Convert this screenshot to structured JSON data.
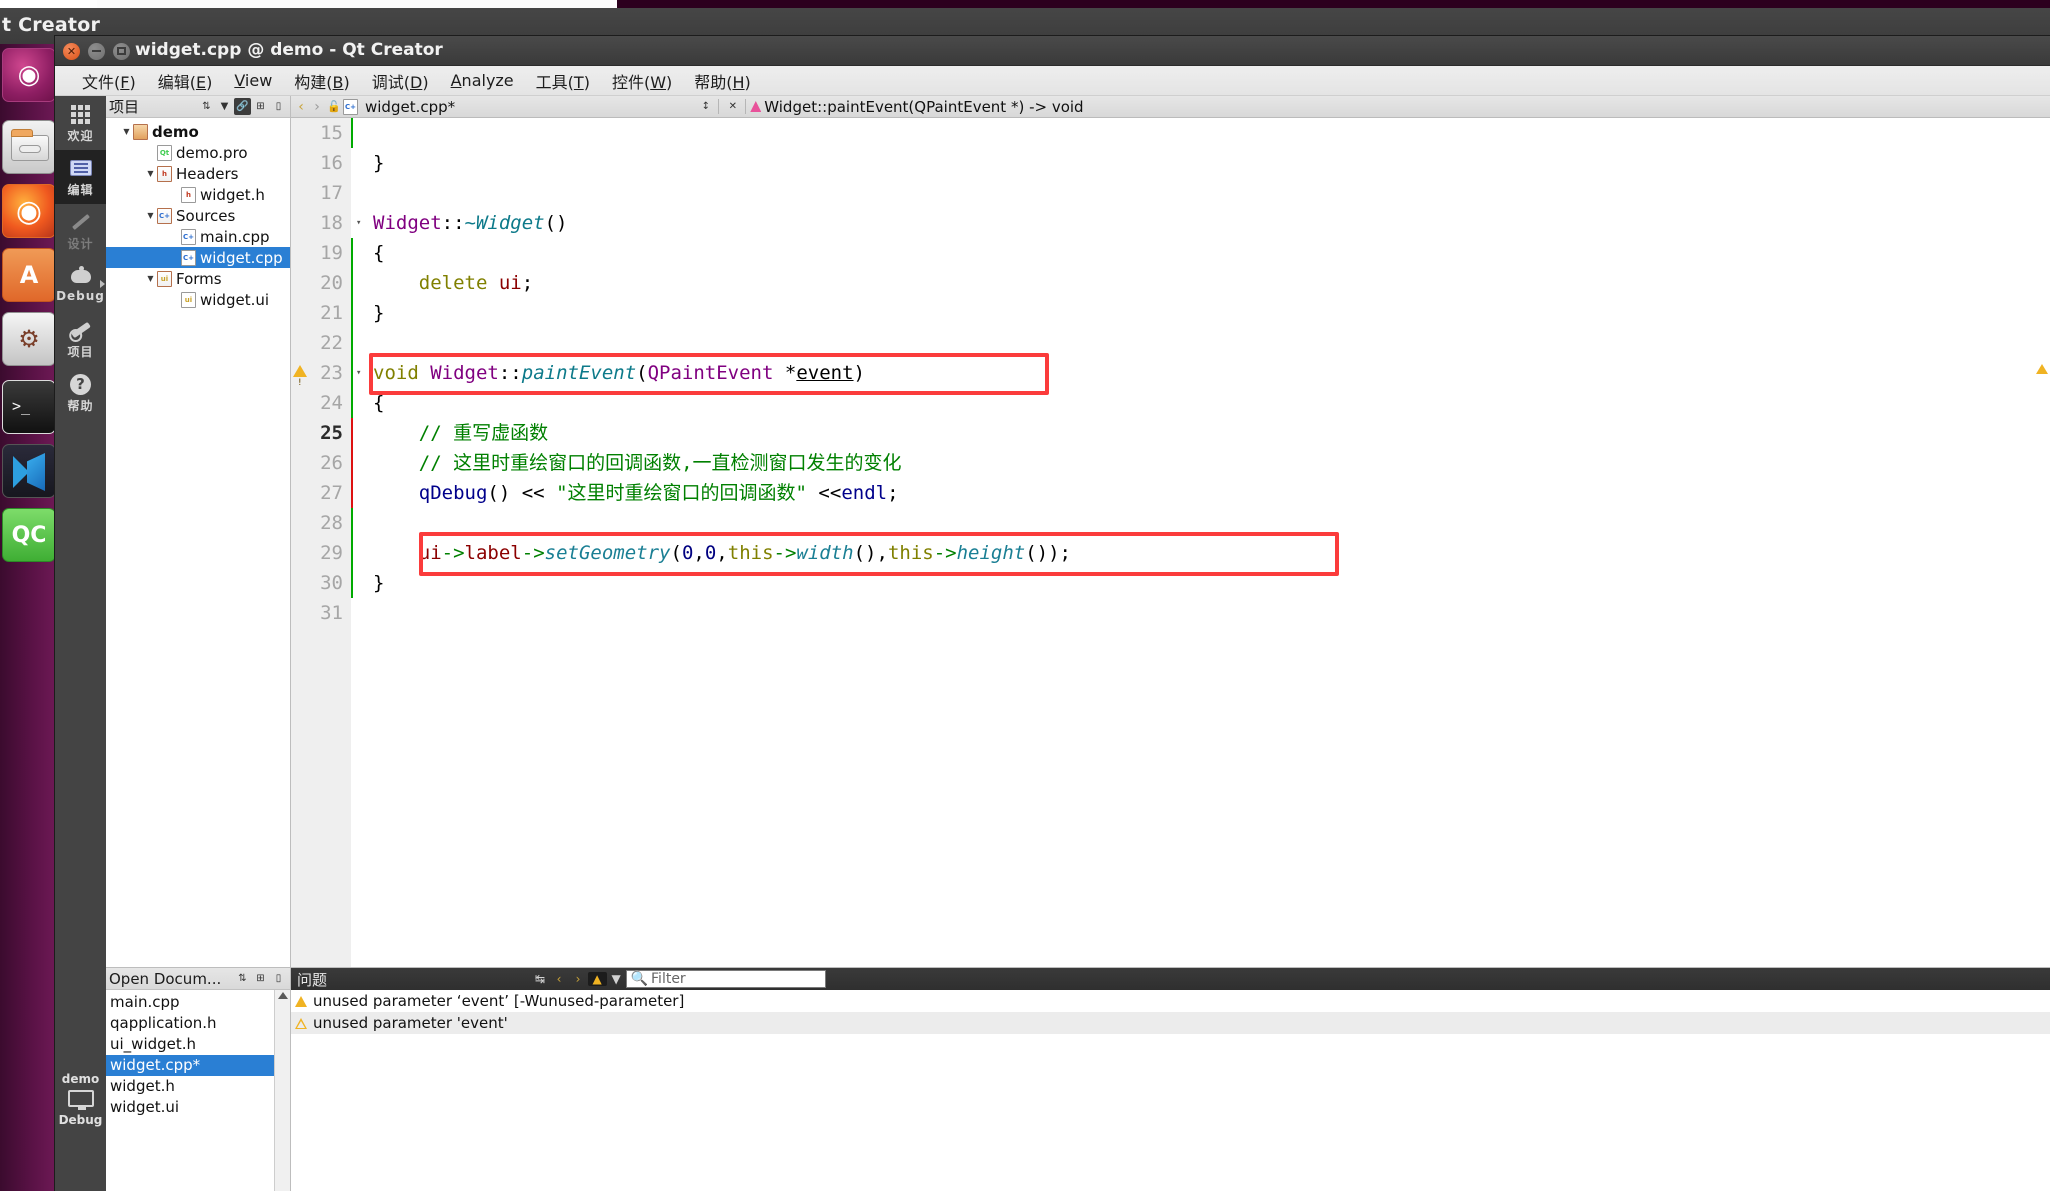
{
  "desktop": {
    "bg_window_title": "t Creator",
    "launcher": [
      {
        "name": "ubuntu-dash-icon",
        "glyph": ""
      },
      {
        "name": "files-icon",
        "glyph": ""
      },
      {
        "name": "firefox-icon",
        "glyph": ""
      },
      {
        "name": "amazon-icon",
        "glyph": "A"
      },
      {
        "name": "system-settings-icon",
        "glyph": ""
      },
      {
        "name": "terminal-icon",
        "glyph": ""
      },
      {
        "name": "vscode-icon",
        "glyph": ""
      },
      {
        "name": "qtcreator-icon",
        "glyph": "QC"
      }
    ]
  },
  "window": {
    "title": "widget.cpp @ demo - Qt Creator",
    "close_glyph": "✕"
  },
  "menubar": [
    {
      "label": "文件(",
      "key": "F",
      "tail": ")"
    },
    {
      "label": "编辑(",
      "key": "E",
      "tail": ")"
    },
    {
      "label": "",
      "key": "V",
      "tail": "iew"
    },
    {
      "label": "构建(",
      "key": "B",
      "tail": ")"
    },
    {
      "label": "调试(",
      "key": "D",
      "tail": ")"
    },
    {
      "label": "",
      "key": "A",
      "tail": "nalyze"
    },
    {
      "label": "工具(",
      "key": "T",
      "tail": ")"
    },
    {
      "label": "控件(",
      "key": "W",
      "tail": ")"
    },
    {
      "label": "帮助(",
      "key": "H",
      "tail": ")"
    }
  ],
  "modebar": {
    "modes": [
      {
        "label": "欢迎",
        "icon": "grid-icon",
        "state": "normal"
      },
      {
        "label": "编辑",
        "icon": "edit-icon",
        "state": "active"
      },
      {
        "label": "设计",
        "icon": "design-pencil-icon",
        "state": "disabled"
      },
      {
        "label": "Debug",
        "icon": "bug-icon",
        "state": "normal"
      },
      {
        "label": "项目",
        "icon": "wrench-icon",
        "state": "normal"
      },
      {
        "label": "帮助",
        "icon": "question-icon",
        "state": "normal"
      }
    ],
    "run_config": {
      "project": "demo",
      "build": "Debug"
    }
  },
  "project_panel": {
    "title": "项目",
    "buttons": [
      "sort-icon",
      "filter-icon",
      "link-icon",
      "expand-icon",
      "collapse-icon"
    ],
    "tree": [
      {
        "label": "demo",
        "depth": 0,
        "icon": "project-icon",
        "twisty": "▼",
        "bold": true,
        "selected": false
      },
      {
        "label": "demo.pro",
        "depth": 1,
        "icon": "qt-pro-icon",
        "twisty": "",
        "bold": false,
        "selected": false
      },
      {
        "label": "Headers",
        "depth": 1,
        "icon": "headers-folder-icon",
        "twisty": "▼",
        "bold": false,
        "selected": false
      },
      {
        "label": "widget.h",
        "depth": 2,
        "icon": "h-file-icon",
        "twisty": "",
        "bold": false,
        "selected": false
      },
      {
        "label": "Sources",
        "depth": 1,
        "icon": "sources-folder-icon",
        "twisty": "▼",
        "bold": false,
        "selected": false
      },
      {
        "label": "main.cpp",
        "depth": 2,
        "icon": "cpp-file-icon",
        "twisty": "",
        "bold": false,
        "selected": false
      },
      {
        "label": "widget.cpp",
        "depth": 2,
        "icon": "cpp-file-icon",
        "twisty": "",
        "bold": false,
        "selected": true
      },
      {
        "label": "Forms",
        "depth": 1,
        "icon": "forms-folder-icon",
        "twisty": "▼",
        "bold": false,
        "selected": false
      },
      {
        "label": "widget.ui",
        "depth": 2,
        "icon": "ui-file-icon",
        "twisty": "",
        "bold": false,
        "selected": false
      }
    ]
  },
  "open_documents": {
    "title": "Open Docum...",
    "buttons": [
      "sort-icon",
      "expand-icon",
      "collapse-icon"
    ],
    "items": [
      {
        "label": "main.cpp",
        "selected": false
      },
      {
        "label": "qapplication.h",
        "selected": false
      },
      {
        "label": "ui_widget.h",
        "selected": false
      },
      {
        "label": "widget.cpp*",
        "selected": true
      },
      {
        "label": "widget.h",
        "selected": false
      },
      {
        "label": "widget.ui",
        "selected": false
      }
    ]
  },
  "editor_toolbar": {
    "back_glyph": "‹",
    "forward_glyph": "›",
    "lock_glyph": "🔓",
    "filename": "widget.cpp*",
    "split_glyph": "↕",
    "close_glyph": "✕",
    "symbol": "Widget::paintEvent(QPaintEvent *) -> void"
  },
  "code": {
    "lines": [
      {
        "num": "15",
        "fold": "",
        "warn": false,
        "current": false,
        "marker": "green",
        "tokens": []
      },
      {
        "num": "16",
        "fold": "",
        "warn": false,
        "current": false,
        "marker": "none",
        "tokens": [
          {
            "t": "}",
            "c": "c-plain"
          }
        ]
      },
      {
        "num": "17",
        "fold": "",
        "warn": false,
        "current": false,
        "marker": "none",
        "tokens": []
      },
      {
        "num": "18",
        "fold": "▾",
        "warn": false,
        "current": false,
        "marker": "none",
        "tokens": [
          {
            "t": "Widget",
            "c": "c-cls"
          },
          {
            "t": "::",
            "c": "c-plain"
          },
          {
            "t": "~Widget",
            "c": "c-fn"
          },
          {
            "t": "()",
            "c": "c-plain"
          }
        ]
      },
      {
        "num": "19",
        "fold": "",
        "warn": false,
        "current": false,
        "marker": "green",
        "tokens": [
          {
            "t": "{",
            "c": "c-plain"
          }
        ]
      },
      {
        "num": "20",
        "fold": "",
        "warn": false,
        "current": false,
        "marker": "green",
        "tokens": [
          {
            "t": "    ",
            "c": "c-plain"
          },
          {
            "t": "delete",
            "c": "c-kw"
          },
          {
            "t": " ",
            "c": "c-plain"
          },
          {
            "t": "ui",
            "c": "c-var"
          },
          {
            "t": ";",
            "c": "c-plain"
          }
        ]
      },
      {
        "num": "21",
        "fold": "",
        "warn": false,
        "current": false,
        "marker": "green",
        "tokens": [
          {
            "t": "}",
            "c": "c-plain"
          }
        ]
      },
      {
        "num": "22",
        "fold": "",
        "warn": false,
        "current": false,
        "marker": "green",
        "tokens": []
      },
      {
        "num": "23",
        "fold": "▾",
        "warn": true,
        "current": false,
        "marker": "green",
        "tokens": [
          {
            "t": "void",
            "c": "c-kw"
          },
          {
            "t": " ",
            "c": "c-plain"
          },
          {
            "t": "Widget",
            "c": "c-cls"
          },
          {
            "t": "::",
            "c": "c-plain"
          },
          {
            "t": "paintEvent",
            "c": "c-fn"
          },
          {
            "t": "(",
            "c": "c-plain"
          },
          {
            "t": "QPaintEvent",
            "c": "c-cls"
          },
          {
            "t": " *",
            "c": "c-plain"
          },
          {
            "t": "event",
            "c": "c-plain u-line"
          },
          {
            "t": ")",
            "c": "c-plain"
          }
        ]
      },
      {
        "num": "24",
        "fold": "",
        "warn": false,
        "current": false,
        "marker": "green",
        "tokens": [
          {
            "t": "{",
            "c": "c-plain"
          }
        ]
      },
      {
        "num": "25",
        "fold": "",
        "warn": false,
        "current": true,
        "marker": "red",
        "tokens": [
          {
            "t": "    // 重写虚函数",
            "c": "c-cmt"
          }
        ]
      },
      {
        "num": "26",
        "fold": "",
        "warn": false,
        "current": false,
        "marker": "red",
        "tokens": [
          {
            "t": "    // 这里时重绘窗口的回调函数,一直检测窗口发生的变化",
            "c": "c-cmt"
          }
        ]
      },
      {
        "num": "27",
        "fold": "",
        "warn": false,
        "current": false,
        "marker": "red",
        "tokens": [
          {
            "t": "    ",
            "c": "c-plain"
          },
          {
            "t": "qDebug",
            "c": "c-qdbg"
          },
          {
            "t": "() ",
            "c": "c-plain"
          },
          {
            "t": "<<",
            "c": "c-op"
          },
          {
            "t": " ",
            "c": "c-plain"
          },
          {
            "t": "\"这里时重绘窗口的回调函数\"",
            "c": "c-str"
          },
          {
            "t": " ",
            "c": "c-plain"
          },
          {
            "t": "<<",
            "c": "c-op"
          },
          {
            "t": "endl",
            "c": "c-qdbg"
          },
          {
            "t": ";",
            "c": "c-plain"
          }
        ]
      },
      {
        "num": "28",
        "fold": "",
        "warn": false,
        "current": false,
        "marker": "green",
        "tokens": []
      },
      {
        "num": "29",
        "fold": "",
        "warn": false,
        "current": false,
        "marker": "green",
        "tokens": [
          {
            "t": "    ",
            "c": "c-plain"
          },
          {
            "t": "ui",
            "c": "c-var"
          },
          {
            "t": "->",
            "c": "c-green"
          },
          {
            "t": "label",
            "c": "c-var"
          },
          {
            "t": "->",
            "c": "c-green"
          },
          {
            "t": "setGeometry",
            "c": "c-fn2"
          },
          {
            "t": "(",
            "c": "c-plain"
          },
          {
            "t": "0",
            "c": "c-num"
          },
          {
            "t": ",",
            "c": "c-plain"
          },
          {
            "t": "0",
            "c": "c-num"
          },
          {
            "t": ",",
            "c": "c-plain"
          },
          {
            "t": "this",
            "c": "c-kw"
          },
          {
            "t": "->",
            "c": "c-green"
          },
          {
            "t": "width",
            "c": "c-fn2"
          },
          {
            "t": "(),",
            "c": "c-plain"
          },
          {
            "t": "this",
            "c": "c-kw"
          },
          {
            "t": "->",
            "c": "c-green"
          },
          {
            "t": "height",
            "c": "c-fn2"
          },
          {
            "t": "());",
            "c": "c-plain"
          }
        ]
      },
      {
        "num": "30",
        "fold": "",
        "warn": false,
        "current": false,
        "marker": "green",
        "tokens": [
          {
            "t": "}",
            "c": "c-plain"
          }
        ]
      },
      {
        "num": "31",
        "fold": "",
        "warn": false,
        "current": false,
        "marker": "none",
        "tokens": []
      }
    ]
  },
  "issues_panel": {
    "title": "问题",
    "filter_placeholder": "Filter",
    "buttons": [
      "clear-icon",
      "prev-issue-icon",
      "next-issue-icon",
      "warning-filter-icon",
      "filter-icon",
      "search-icon"
    ],
    "rows": [
      {
        "severity": "warning-solid",
        "text": "unused parameter ‘event’ [-Wunused-parameter]"
      },
      {
        "severity": "warning-hollow",
        "text": "unused parameter 'event'"
      }
    ]
  },
  "colors": {
    "accent_selection": "#2a7fd4",
    "highlight_box": "#fb3b3b",
    "warning": "#f0b323",
    "launcher_bg": "#5a1246"
  }
}
